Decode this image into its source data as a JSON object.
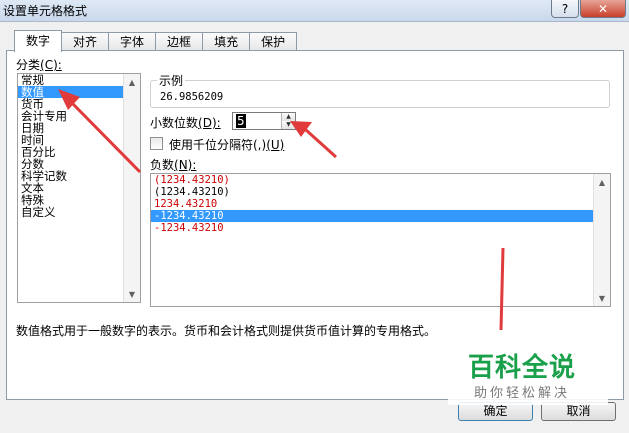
{
  "window": {
    "title": "设置单元格格式",
    "help": "?",
    "close": "✕"
  },
  "tabs": [
    {
      "label": "数字",
      "active": true
    },
    {
      "label": "对齐"
    },
    {
      "label": "字体"
    },
    {
      "label": "边框"
    },
    {
      "label": "填充"
    },
    {
      "label": "保护"
    }
  ],
  "category": {
    "label": "分类",
    "hotkey": "(C):",
    "items": [
      "常规",
      "数值",
      "货币",
      "会计专用",
      "日期",
      "时间",
      "百分比",
      "分数",
      "科学记数",
      "文本",
      "特殊",
      "自定义"
    ],
    "selected_index": 1
  },
  "sample": {
    "title": "示例",
    "value": "26.9856209"
  },
  "decimal": {
    "label": "小数位数",
    "hotkey": "(D):",
    "value": "5"
  },
  "thousands": {
    "label": "使用千位分隔符(,)",
    "hotkey": "(U)",
    "checked": false
  },
  "negative": {
    "label": "负数",
    "hotkey": "(N):",
    "items": [
      {
        "text": "(1234.43210)",
        "color": "#cc0000"
      },
      {
        "text": "(1234.43210)",
        "color": "#000000"
      },
      {
        "text": "1234.43210",
        "color": "#cc0000"
      },
      {
        "text": "-1234.43210",
        "color": "#ffffff",
        "selected": true
      },
      {
        "text": "-1234.43210",
        "color": "#cc0000"
      }
    ]
  },
  "description": "数值格式用于一般数字的表示。货币和会计格式则提供货币值计算的专用格式。",
  "buttons": {
    "ok": "确定",
    "cancel": "取消"
  },
  "watermark": {
    "main": "百科全说",
    "sub": "助你轻松解决"
  },
  "colors": {
    "selection": "#3399ff",
    "annotation_arrow": "#e03a3a",
    "watermark_green": "#1aa04a"
  }
}
